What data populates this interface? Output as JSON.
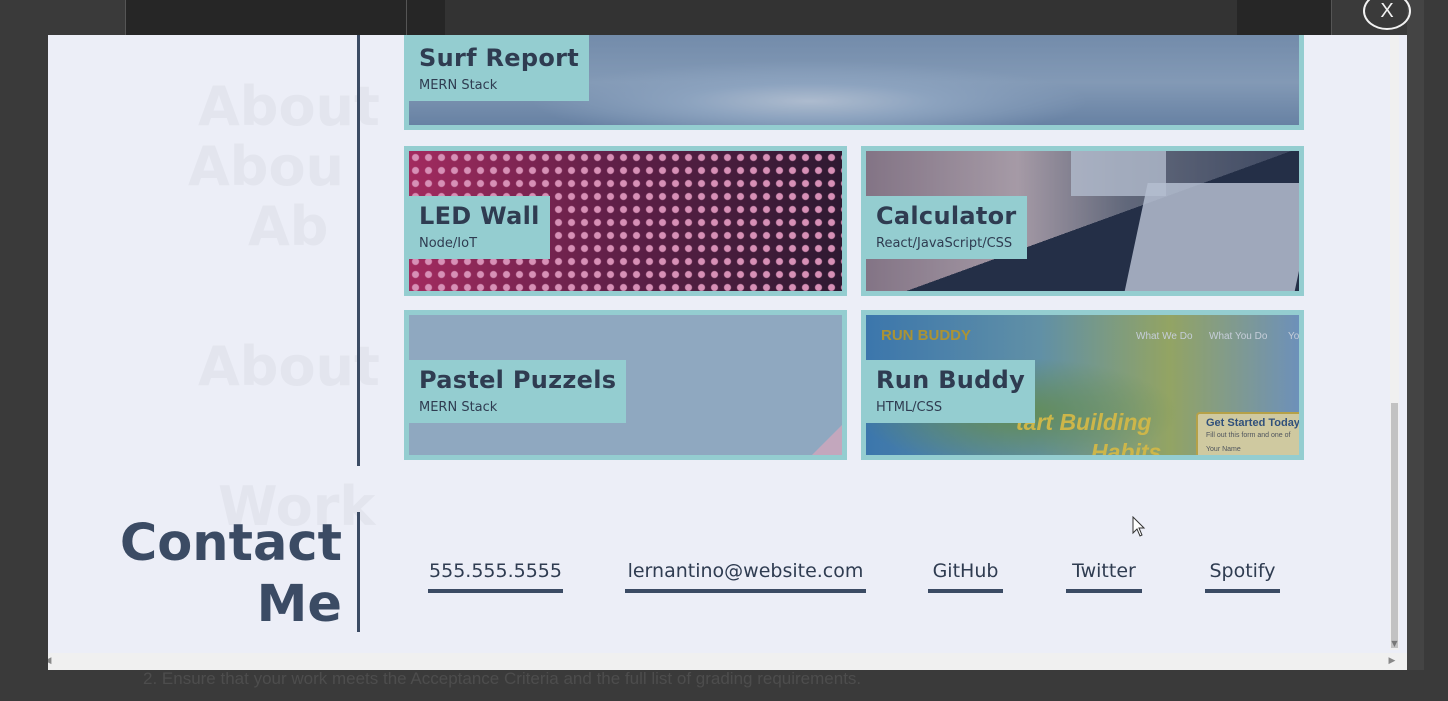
{
  "background": {
    "instruction_line": "2. Ensure that your work meets the Acceptance Criteria and the full list of grading requirements."
  },
  "close_button": {
    "label": "X"
  },
  "work_section": {
    "ghost_texts": [
      "About",
      "Abou",
      "Ab",
      "Work"
    ],
    "projects": [
      {
        "title": "Surf Report",
        "stack": "MERN Stack"
      },
      {
        "title": "LED Wall",
        "stack": "Node/IoT"
      },
      {
        "title": "Calculator",
        "stack": "React/JavaScript/CSS"
      },
      {
        "title": "Pastel Puzzels",
        "stack": "MERN Stack"
      },
      {
        "title": "Run Buddy",
        "stack": "HTML/CSS"
      }
    ],
    "run_buddy_preview": {
      "logo": "RUN BUDDY",
      "nav": [
        "What We Do",
        "What You Do",
        "Yo"
      ],
      "hero_line1": "tart Building",
      "hero_line2": "Habits",
      "form_title": "Get Started Today",
      "form_sub": "Fill out this form and one of",
      "form_name": "Your Name"
    }
  },
  "contact": {
    "heading_line1": "Contact",
    "heading_line2": "Me",
    "links": [
      "555.555.5555",
      "lernantino@website.com",
      "GitHub",
      "Twitter",
      "Spotify"
    ]
  },
  "colors": {
    "accent": "#94cdd0",
    "navy": "#3b4b64",
    "modal_bg": "#eceef7",
    "overlay": "#2f2f2f"
  }
}
